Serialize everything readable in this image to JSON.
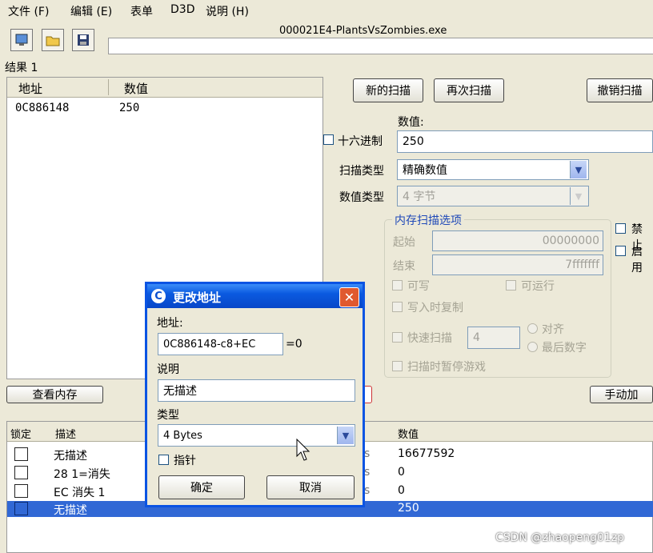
{
  "menu": [
    "文件 (F)",
    "编辑 (E)",
    "表单",
    "D3D",
    "说明 (H)"
  ],
  "window_title": "000021E4-PlantsVsZombies.exe",
  "results_label": "结果 1",
  "results_table": {
    "headers": [
      "地址",
      "数值"
    ],
    "rows": [
      {
        "address": "0C886148",
        "value": "250"
      }
    ]
  },
  "scan_buttons": {
    "new_scan": "新的扫描",
    "next_scan": "再次扫描",
    "undo_scan": "撤销扫描"
  },
  "value_label": "数值:",
  "hex_label": "十六进制",
  "value_input": "250",
  "scan_type_label": "扫描类型",
  "scan_type_value": "精确数值",
  "value_type_label": "数值类型",
  "value_type_value": "4 字节",
  "memory_options": {
    "title": "内存扫描选项",
    "start_label": "起始",
    "start_value": "00000000",
    "end_label": "结束",
    "end_value": "7fffffff",
    "writable": "可写",
    "executable": "可运行",
    "copy_on_write": "写入时复制",
    "fast_scan": "快速扫描",
    "fast_scan_value": "4",
    "align": "对齐",
    "last_digits": "最后数字",
    "pause_game": "扫描时暂停游戏"
  },
  "right_checks": [
    "禁止",
    "启用"
  ],
  "view_memory_button": "查看内存",
  "manual_add_button": "手动加",
  "address_list": {
    "headers": {
      "lock": "锁定",
      "desc": "描述",
      "value": "数值"
    },
    "rows": [
      {
        "desc": "无描述",
        "type_frag": "s",
        "value": "16677592"
      },
      {
        "desc": "28 1=消失",
        "type_frag": "s",
        "value": "0"
      },
      {
        "desc": "EC 消失 1",
        "type_frag": "s",
        "value": "0"
      },
      {
        "desc": "无描述",
        "type_frag": "",
        "value": "250"
      }
    ]
  },
  "dialog": {
    "title": "更改地址",
    "address_label": "地址:",
    "address_value": "0C886148-c8+EC",
    "address_result": "=0",
    "desc_label": "说明",
    "desc_value": "无描述",
    "type_label": "类型",
    "type_value": "4 Bytes",
    "pointer_label": "指针",
    "ok": "确定",
    "cancel": "取消"
  },
  "watermark": "CSDN @zhaopeng01zp",
  "colors": {
    "selection": "#3168d5",
    "title_bar": "#0a5ae0",
    "close": "#e0592f"
  }
}
